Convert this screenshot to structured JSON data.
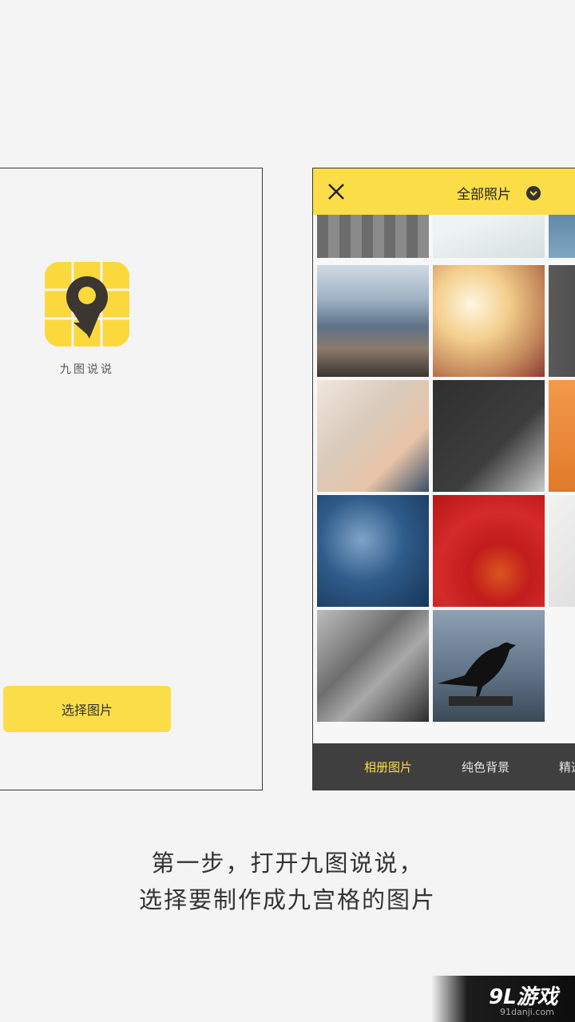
{
  "left_screen": {
    "app_name": "九图说说",
    "choose_button": "选择图片"
  },
  "right_screen": {
    "album_title": "全部照片",
    "tabs": [
      {
        "label": "相册图片",
        "active": true
      },
      {
        "label": "纯色背景",
        "active": false
      },
      {
        "label": "精选",
        "active": false
      }
    ],
    "photos": [
      "wood-plank-photo",
      "green-leaf-photo",
      "ocean-photo",
      "mountain-lake-photo",
      "woman-sunlight-photo",
      "city-building-photo",
      "bed-feet-photo",
      "phone-desk-photo",
      "orange-photo",
      "birds-water-photo",
      "pumpkin-red-photo",
      "chopsticks-photo",
      "broken-phone-photo",
      "crow-photo"
    ]
  },
  "caption": {
    "line1": "第一步，打开九图说说，",
    "line2": "选择要制作成九宫格的图片"
  },
  "watermark": {
    "brand": "9L游戏",
    "site": "91danji.com"
  },
  "colors": {
    "accent": "#fbdd48",
    "dark_bar": "#3f3f3f"
  }
}
